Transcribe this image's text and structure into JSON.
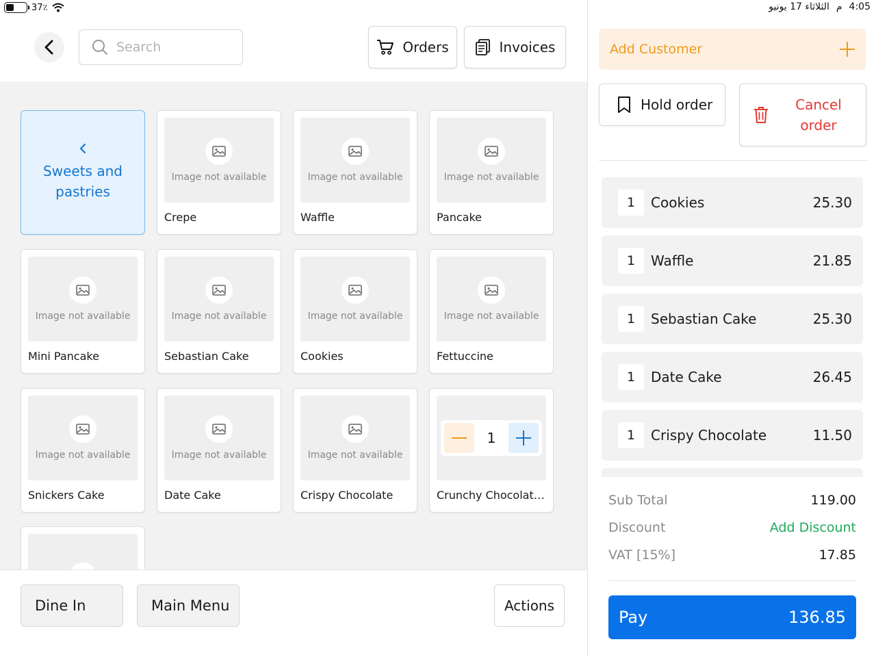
{
  "status": {
    "battery": "37٪",
    "time": "4:05",
    "ampm": "م",
    "date": "الثلاثاء 17 يونيو"
  },
  "header": {
    "search_placeholder": "Search",
    "orders_label": "Orders",
    "invoices_label": "Invoices"
  },
  "category": {
    "label": "Sweets and pastries"
  },
  "image_placeholder_text": "Image not available",
  "products": [
    {
      "name": "Crepe"
    },
    {
      "name": "Waffle"
    },
    {
      "name": "Pancake"
    },
    {
      "name": "Mini Pancake"
    },
    {
      "name": "Sebastian Cake"
    },
    {
      "name": "Cookies"
    },
    {
      "name": "Fettuccine"
    },
    {
      "name": "Snickers Cake"
    },
    {
      "name": "Date Cake"
    },
    {
      "name": "Crispy Chocolate"
    },
    {
      "name": "Crunchy Chocolate ...",
      "stepper_qty": "1"
    }
  ],
  "bottom": {
    "dine_in": "Dine In",
    "main_menu": "Main Menu",
    "actions": "Actions"
  },
  "cart": {
    "add_customer": "Add Customer",
    "hold_order": "Hold order",
    "cancel_order": "Cancel order",
    "items": [
      {
        "qty": "1",
        "name": "Cookies",
        "price": "25.30"
      },
      {
        "qty": "1",
        "name": "Waffle",
        "price": "21.85"
      },
      {
        "qty": "1",
        "name": "Sebastian Cake",
        "price": "25.30"
      },
      {
        "qty": "1",
        "name": "Date Cake",
        "price": "26.45"
      },
      {
        "qty": "1",
        "name": "Crispy Chocolate",
        "price": "11.50"
      }
    ],
    "subtotal_label": "Sub Total",
    "subtotal_value": "119.00",
    "discount_label": "Discount",
    "add_discount": "Add Discount",
    "vat_label": "VAT [15%]",
    "vat_value": "17.85",
    "pay_label": "Pay",
    "pay_total": "136.85"
  },
  "colors": {
    "accent": "#0a72e8",
    "category_bg": "#e6f2fd",
    "customer_bg": "#fdf0e0",
    "customer_text": "#ef9a1c",
    "danger": "#e53935",
    "success": "#1eaa5a"
  }
}
